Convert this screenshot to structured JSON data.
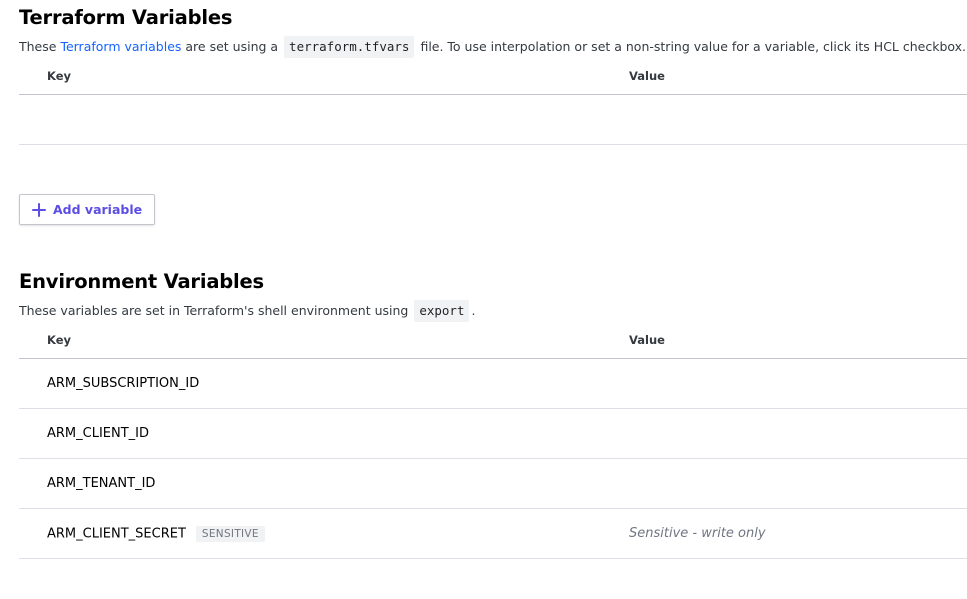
{
  "terraform_section": {
    "title": "Terraform Variables",
    "desc_prefix": "These ",
    "desc_link": "Terraform variables",
    "desc_middle": " are set using a ",
    "desc_code": "terraform.tfvars",
    "desc_suffix": " file. To use interpolation or set a non-string value for a variable, click its HCL checkbox.",
    "columns": {
      "key": "Key",
      "value": "Value"
    },
    "rows": [],
    "add_button_label": "Add variable"
  },
  "environment_section": {
    "title": "Environment Variables",
    "desc_prefix": "These variables are set in Terraform's shell environment using ",
    "desc_code": "export",
    "desc_suffix": ".",
    "columns": {
      "key": "Key",
      "value": "Value"
    },
    "rows": [
      {
        "key": "ARM_SUBSCRIPTION_ID",
        "badge": "",
        "value": ""
      },
      {
        "key": "ARM_CLIENT_ID",
        "badge": "",
        "value": ""
      },
      {
        "key": "ARM_TENANT_ID",
        "badge": "",
        "value": ""
      },
      {
        "key": "ARM_CLIENT_SECRET",
        "badge": "SENSITIVE",
        "value": "Sensitive - write only"
      }
    ]
  },
  "colors": {
    "accent": "#5c4ee5",
    "link": "#1563ff",
    "muted": "#6f7682",
    "border": "#dce0e6"
  }
}
